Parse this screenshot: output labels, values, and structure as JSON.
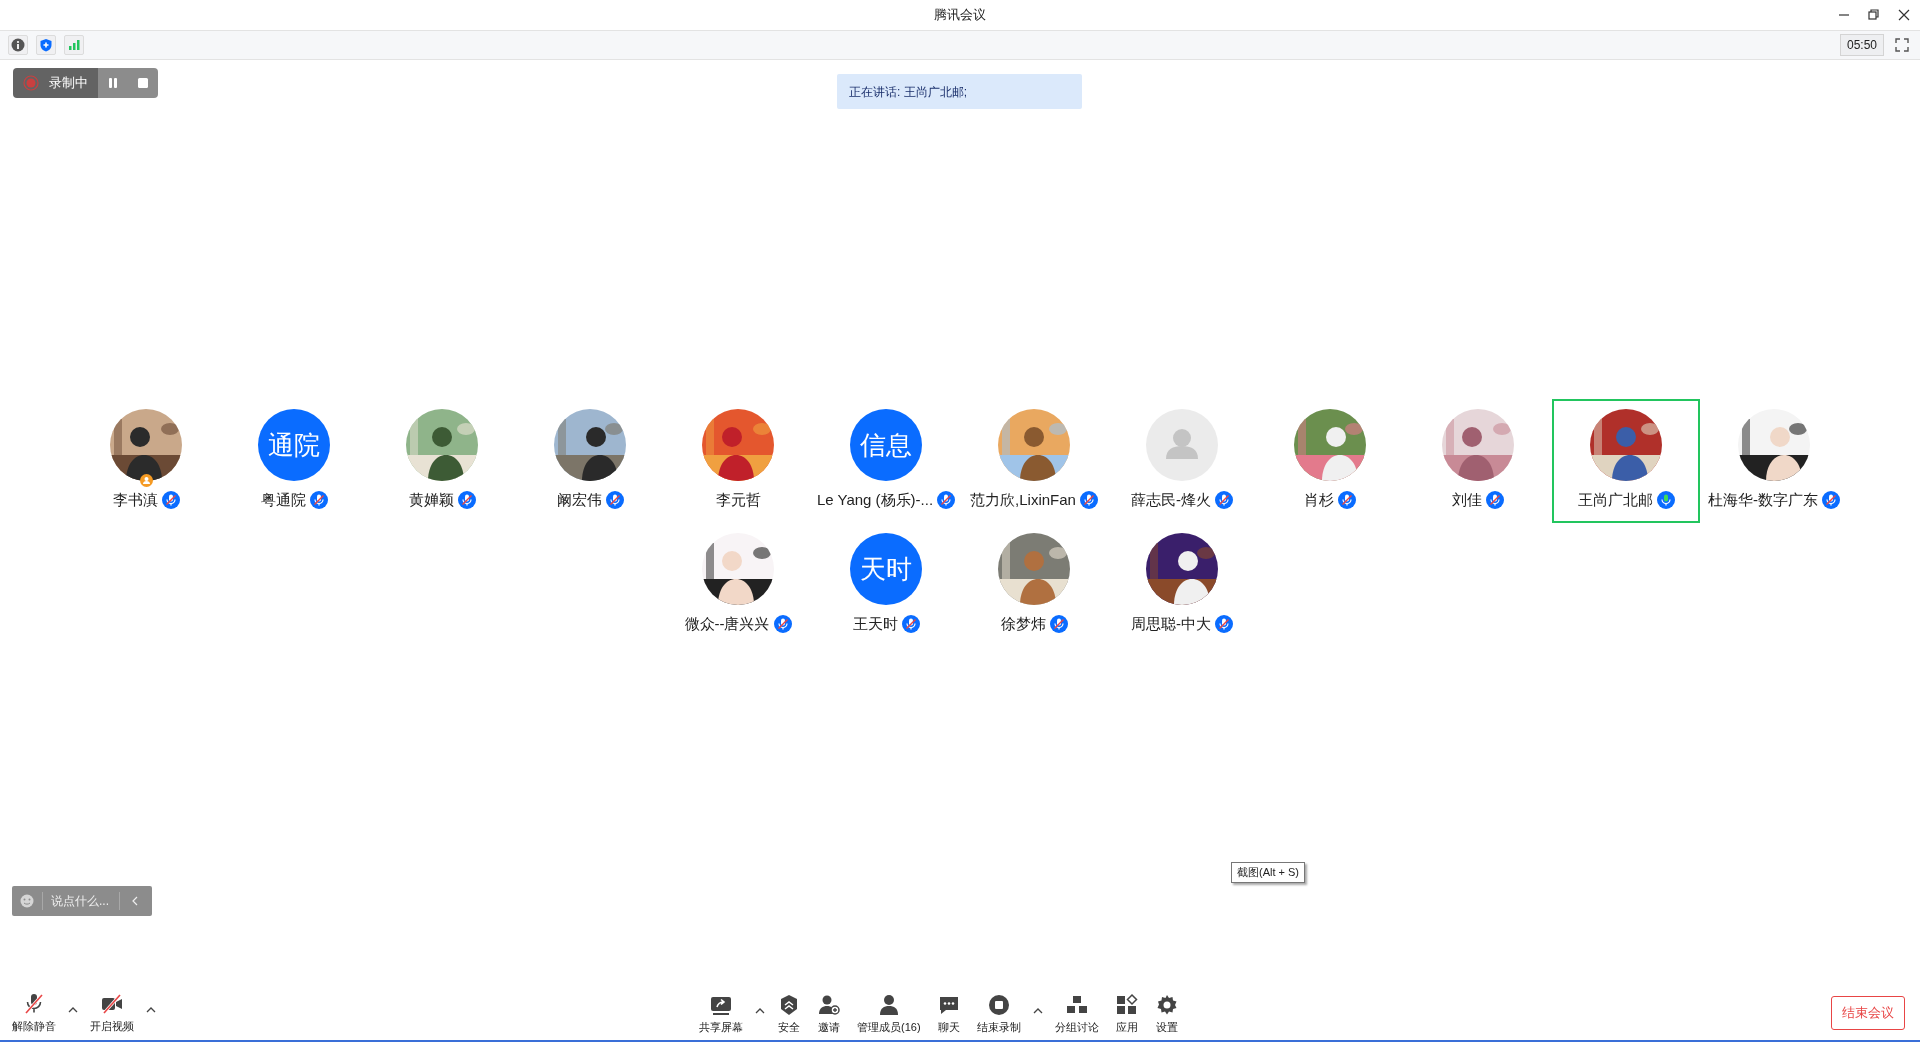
{
  "window": {
    "title": "腾讯会议"
  },
  "info_bar": {
    "timer": "05:50"
  },
  "recording": {
    "label": "录制中"
  },
  "speaking_banner": "正在讲话: 王尚广北邮;",
  "participants": [
    {
      "name": "李书滇",
      "mic": {
        "muted": true
      },
      "host": true,
      "active_speaker": false
    },
    {
      "name": "粤通院",
      "avatar": {
        "kind": "text",
        "initials": "通院"
      },
      "mic": {
        "muted": true
      },
      "host": false,
      "active_speaker": false
    },
    {
      "name": "黄婵颖",
      "mic": {
        "muted": true
      },
      "host": false,
      "active_speaker": false
    },
    {
      "name": "阚宏伟",
      "mic": {
        "muted": true
      },
      "host": false,
      "active_speaker": false
    },
    {
      "name": "李元哲",
      "host": false,
      "active_speaker": false
    },
    {
      "name": "Le Yang (杨乐)-...",
      "avatar": {
        "kind": "text",
        "initials": "信息"
      },
      "mic": {
        "muted": true
      },
      "host": false,
      "active_speaker": false
    },
    {
      "name": "范力欣,LixinFan",
      "mic": {
        "muted": true
      },
      "host": false,
      "active_speaker": false
    },
    {
      "name": "薛志民-烽火",
      "avatar": {
        "kind": "default"
      },
      "mic": {
        "muted": true
      },
      "host": false,
      "active_speaker": false
    },
    {
      "name": "肖杉",
      "mic": {
        "muted": true
      },
      "host": false,
      "active_speaker": false
    },
    {
      "name": "刘佳",
      "mic": {
        "muted": true
      },
      "host": false,
      "active_speaker": false
    },
    {
      "name": "王尚广北邮",
      "mic": {
        "muted": false
      },
      "host": false,
      "active_speaker": true
    },
    {
      "name": "杜海华-数字广东",
      "mic": {
        "muted": true
      },
      "host": false,
      "active_speaker": false
    },
    {
      "name": "微众--唐兴兴",
      "mic": {
        "muted": true
      },
      "host": false,
      "active_speaker": false
    },
    {
      "name": "王天时",
      "avatar": {
        "kind": "text",
        "initials": "天时"
      },
      "mic": {
        "muted": true
      },
      "host": false,
      "active_speaker": false
    },
    {
      "name": "徐梦炜",
      "mic": {
        "muted": true
      },
      "host": false,
      "active_speaker": false
    },
    {
      "name": "周思聪-中大",
      "mic": {
        "muted": true
      },
      "host": false,
      "active_speaker": false
    }
  ],
  "chat": {
    "placeholder": "说点什么..."
  },
  "tooltip": "截图(Alt + S)",
  "toolbar": {
    "left": [
      {
        "kind": "tool",
        "label": "解除静音",
        "off": true
      },
      {
        "kind": "caret"
      },
      {
        "kind": "tool",
        "label": "开启视频",
        "off": true
      },
      {
        "kind": "caret"
      }
    ],
    "center": [
      {
        "kind": "tool",
        "label": "共享屏幕",
        "off": false
      },
      {
        "kind": "caret"
      },
      {
        "kind": "tool",
        "label": "安全",
        "off": false
      },
      {
        "kind": "tool",
        "label": "邀请",
        "off": false
      },
      {
        "kind": "tool",
        "label": "管理成员(16)",
        "off": false
      },
      {
        "kind": "tool",
        "label": "聊天",
        "off": false
      },
      {
        "kind": "tool",
        "label": "结束录制",
        "off": false
      },
      {
        "kind": "caret"
      },
      {
        "kind": "tool",
        "label": "分组讨论",
        "off": false
      },
      {
        "kind": "tool",
        "label": "应用",
        "off": false
      },
      {
        "kind": "tool",
        "label": "设置",
        "off": false
      }
    ]
  },
  "end_button": "结束会议"
}
